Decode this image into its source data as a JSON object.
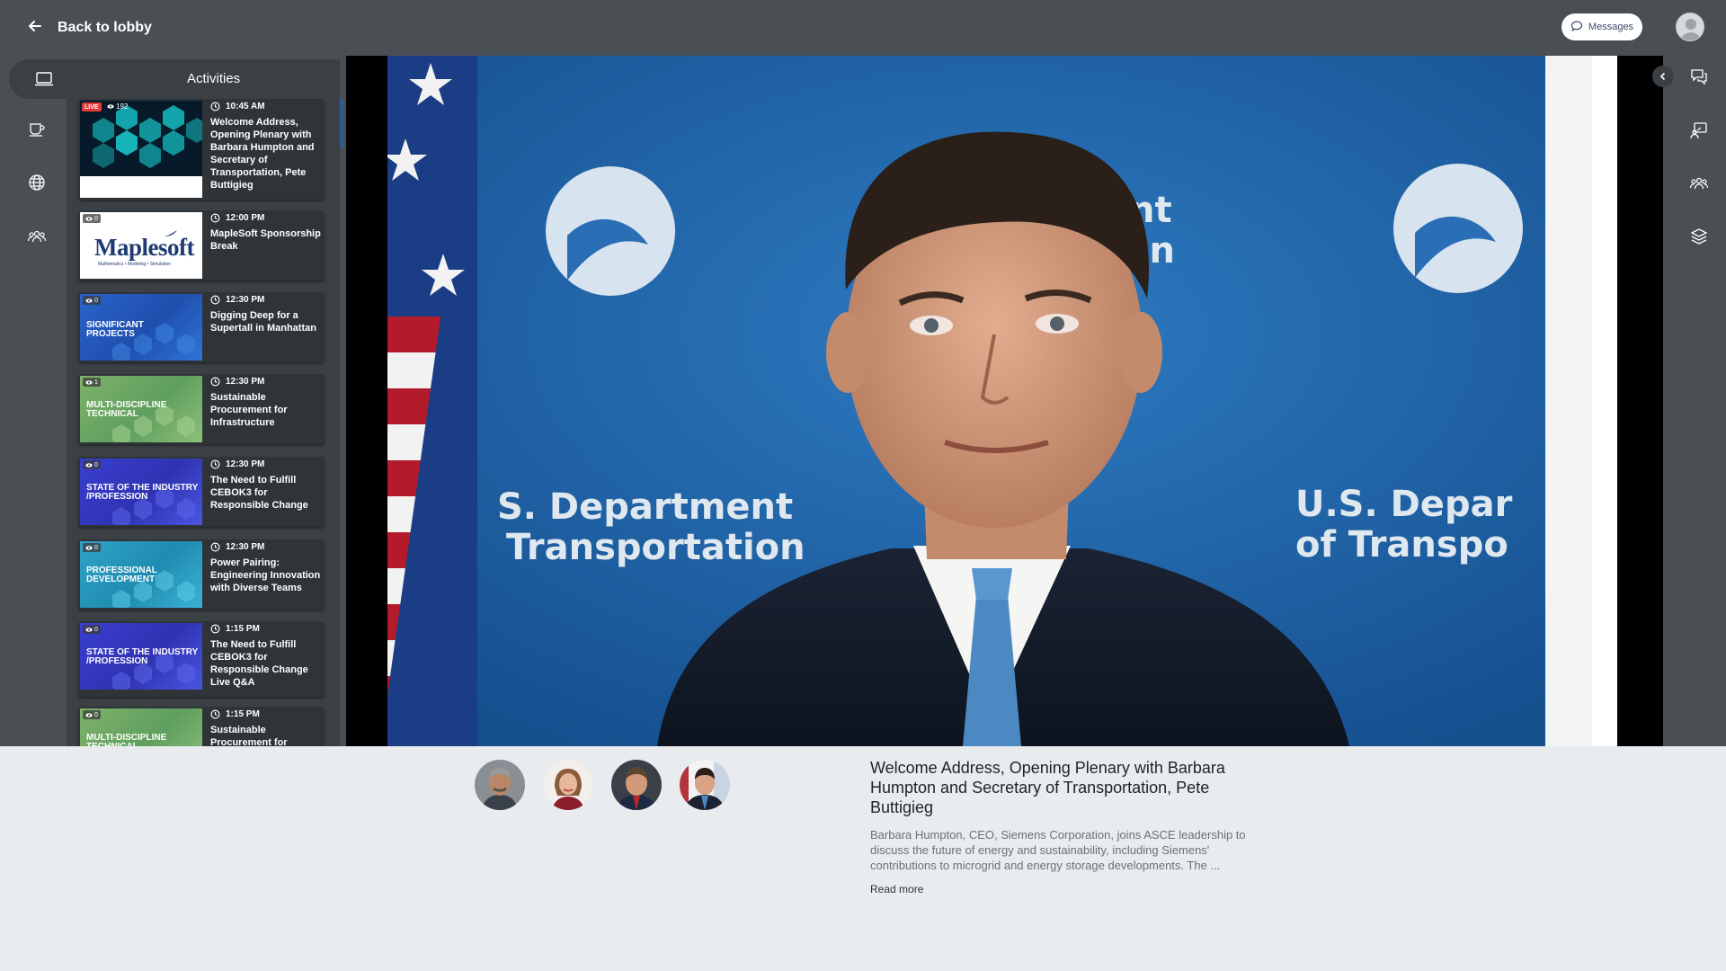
{
  "header": {
    "back_label": "Back to lobby",
    "messages_label": "Messages"
  },
  "activities": {
    "title": "Activities",
    "items": [
      {
        "time": "10:45 AM",
        "title": "Welcome Address, Opening Plenary with Barbara Humpton and Secretary of Transportation, Pete Buttigieg",
        "live": "LIVE",
        "views": "192",
        "thumb": "hex"
      },
      {
        "time": "12:00 PM",
        "title": "MapleSoft Sponsorship Break",
        "views": "0",
        "thumb": "maplesoft",
        "logo": "Maplesoft",
        "logo_tagline": "Mathematics • Modeling • Simulation"
      },
      {
        "time": "12:30 PM",
        "title": "Digging Deep for a Supertall in Manhattan",
        "views": "0",
        "thumb": "blue",
        "label": "SIGNIFICANT PROJECTS"
      },
      {
        "time": "12:30 PM",
        "title": "Sustainable Procurement for Infrastructure",
        "views": "1",
        "thumb": "green",
        "label": "MULTI-DISCIPLINE TECHNICAL"
      },
      {
        "time": "12:30 PM",
        "title": "The Need to Fulfill CEBOK3 for Responsible Change",
        "views": "0",
        "thumb": "indigo",
        "label": "STATE OF THE INDUSTRY /PROFESSION"
      },
      {
        "time": "12:30 PM",
        "title": "Power Pairing: Engineering Innovation with Diverse Teams",
        "views": "0",
        "thumb": "teal",
        "label": "PROFESSIONAL DEVELOPMENT"
      },
      {
        "time": "1:15 PM",
        "title": "The Need to Fulfill CEBOK3 for Responsible Change Live Q&A",
        "views": "0",
        "thumb": "indigo",
        "label": "STATE OF THE INDUSTRY /PROFESSION"
      },
      {
        "time": "1:15 PM",
        "title": "Sustainable Procurement for",
        "views": "0",
        "thumb": "green",
        "label": "MULTI-DISCIPLINE TECHNICAL"
      }
    ]
  },
  "video": {
    "backdrop_text_left_1": "S. Department",
    "backdrop_text_left_2": "Transportation",
    "backdrop_text_right_1": "U.S. Depar",
    "backdrop_text_right_2": "of Transpo",
    "backdrop_text_center_1": "nt",
    "backdrop_text_center_2": "on"
  },
  "session": {
    "title": "Welcome Address, Opening Plenary with Barbara Humpton and Secretary of Transportation, Pete Buttigieg",
    "description": "Barbara Humpton, CEO, Siemens Corporation, joins ASCE leadership to discuss the future of energy and sustainability, including Siemens' contributions to microgrid and energy storage developments. The ...",
    "read_more": "Read more",
    "speaker_count": 4
  },
  "colors": {
    "topbar": "#4a4f54",
    "panel": "#3b4045",
    "card": "#2f3439",
    "live": "#e53935",
    "accent_scroll": "#2b5c9a",
    "page_bg": "#e9ecee"
  }
}
